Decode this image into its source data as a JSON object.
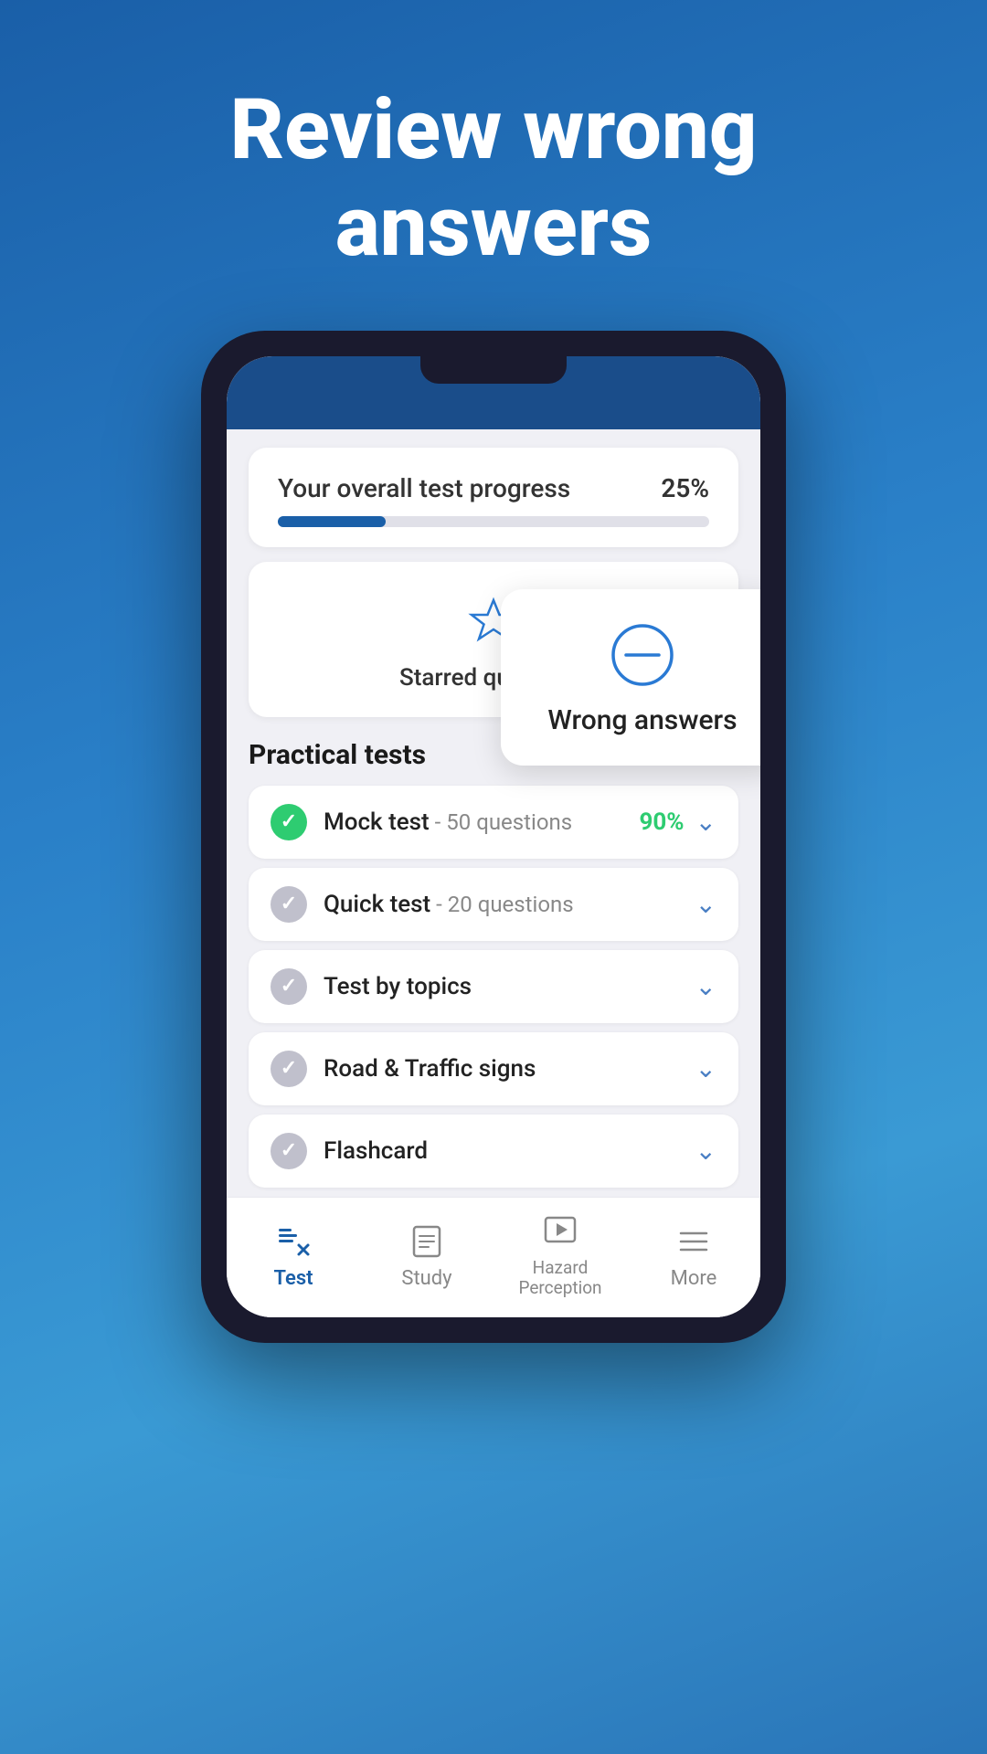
{
  "hero": {
    "title": "Review wrong answers"
  },
  "app": {
    "progress_card": {
      "label": "Your overall test progress",
      "percent": "25%",
      "fill_width": "25%"
    },
    "starred_card": {
      "label": "Starred questions"
    },
    "wrong_answers_card": {
      "label": "Wrong answers"
    },
    "practical_tests": {
      "heading": "Practical tests",
      "items": [
        {
          "check": "green",
          "text": "Mock test",
          "sub": " - 50 questions",
          "percent": "90%",
          "has_percent": true
        },
        {
          "check": "gray",
          "text": "Quick test",
          "sub": " - 20 questions",
          "percent": "",
          "has_percent": false
        },
        {
          "check": "gray",
          "text": "Test by topics",
          "sub": "",
          "percent": "",
          "has_percent": false
        },
        {
          "check": "gray",
          "text": "Road & Traffic signs",
          "sub": "",
          "percent": "",
          "has_percent": false
        },
        {
          "check": "gray",
          "text": "Flashcard",
          "sub": "",
          "percent": "",
          "has_percent": false
        }
      ]
    },
    "bottom_nav": {
      "items": [
        {
          "label": "Test",
          "active": true
        },
        {
          "label": "Study",
          "active": false
        },
        {
          "label": "Hazard\nPerception",
          "active": false
        },
        {
          "label": "More",
          "active": false
        }
      ]
    }
  }
}
